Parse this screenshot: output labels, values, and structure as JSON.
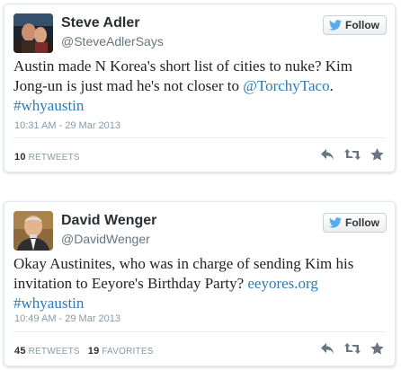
{
  "colors": {
    "link": "#2b7bb9",
    "name": "#292f33",
    "meta": "#8899a6",
    "icon": "#6a757f",
    "bird": "#55acee"
  },
  "tweets": [
    {
      "name": "Steve Adler",
      "handle": "@SteveAdlerSays",
      "follow_label": "Follow",
      "text": {
        "line1": "Austin made N Korea's short list of cities to nuke? Kim Jong-un is just mad he's not closer to ",
        "mention": "@TorchyTaco",
        "after_mention": ".",
        "hashtag": "#whyaustin"
      },
      "timestamp": "10:31 AM - 29 Mar 2013",
      "retweets_count": "10",
      "retweets_label": "RETWEETS"
    },
    {
      "name": "David Wenger",
      "handle": "@DavidWenger",
      "follow_label": "Follow",
      "text": {
        "line1": "Okay Austinites, who was in charge of sending Kim his invitation to Eeyore's Birthday Party? ",
        "link": "eeyores.org",
        "hashtag": "#whyaustin"
      },
      "timestamp": "10:49 AM - 29 Mar 2013",
      "retweets_count": "45",
      "retweets_label": "RETWEETS",
      "favorites_count": "19",
      "favorites_label": "FAVORITES"
    }
  ]
}
